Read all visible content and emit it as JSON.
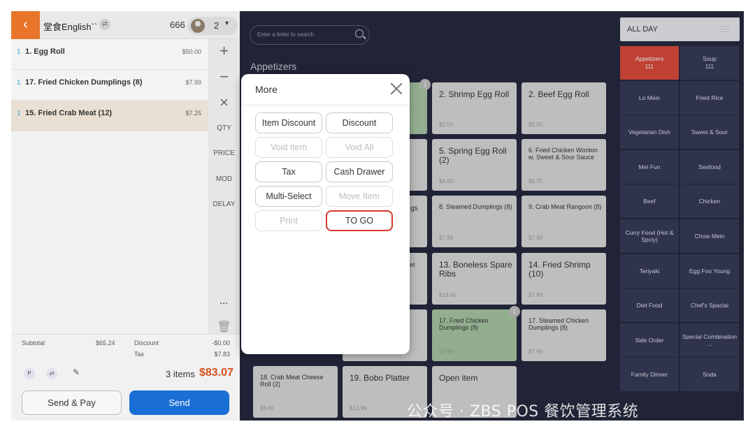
{
  "header": {
    "back_icon": "chevron-left-icon",
    "store_name": "堂食English``",
    "table_number": "666",
    "guest_count": "2"
  },
  "order_items": [
    {
      "qty": "1",
      "name": "1. Egg Roll",
      "price": "$50.00",
      "selected": false
    },
    {
      "qty": "1",
      "name": "17. Fried Chicken Dumplings (8)",
      "price": "$7.99",
      "selected": false
    },
    {
      "qty": "1",
      "name": "15. Fried Crab Meat (12)",
      "price": "$7.25",
      "selected": true
    }
  ],
  "side_tools": {
    "add": "+",
    "minus": "−",
    "remove": "×",
    "qty": "QTY",
    "price": "PRICE",
    "mod": "MOD",
    "delay": "DELAY",
    "more": "···"
  },
  "totals": {
    "subtotal_label": "Subtotal",
    "subtotal_value": "$65.24",
    "discount_label": "Discount",
    "discount_value": "-$0.00",
    "tax_label": "Tax",
    "tax_value": "$7.83",
    "p_badge": "P",
    "items_count": "3 items",
    "grand_total": "$83.07"
  },
  "actions": {
    "send_pay": "Send & Pay",
    "send": "Send"
  },
  "search": {
    "placeholder": "Enter a letter to search"
  },
  "category_title": "Appetizers",
  "menu_tiles": [
    {
      "name": "2. Shrimp Egg Roll",
      "price": "$2.50",
      "small": false,
      "green": false,
      "badge": ""
    },
    {
      "name": "2. Beef Egg Roll",
      "price": "$2.50",
      "small": false,
      "green": false,
      "badge": ""
    },
    {
      "name": "5. Spring Egg Roll (2)",
      "price": "$4.00",
      "small": false,
      "green": false,
      "badge": ""
    },
    {
      "name": "6. Fried Chicken Wonton w. Sweet & Sour Sauce",
      "price": "$5.75",
      "small": true,
      "green": false,
      "badge": ""
    },
    {
      "name": "8. Steamed Dumplings (8)",
      "price": "$7.99",
      "small": true,
      "green": false,
      "badge": ""
    },
    {
      "name": "9. Crab Meat Rangoon (8)",
      "price": "$7.99",
      "small": true,
      "green": false,
      "badge": ""
    },
    {
      "name": "13. Boneless Spare Ribs",
      "price": "$13.45",
      "small": false,
      "green": false,
      "badge": ""
    },
    {
      "name": "14. Fried Shrimp (10)",
      "price": "$7.99",
      "small": false,
      "green": false,
      "badge": ""
    },
    {
      "name": "17. Fried Chicken Dumplings (8)",
      "price": "$7.99",
      "small": true,
      "green": true,
      "badge": "1"
    },
    {
      "name": "17. Steamed Chicken Dumplings (8)",
      "price": "$7.99",
      "small": true,
      "green": false,
      "badge": ""
    },
    {
      "name": "18. Crab Meat Cheese Roll (2)",
      "price": "$5.00",
      "small": true,
      "green": false,
      "badge": ""
    },
    {
      "name": "19. Bobo Platter",
      "price": "$13.99",
      "small": false,
      "green": false,
      "badge": ""
    },
    {
      "name": "Open item",
      "price": "",
      "small": false,
      "green": false,
      "badge": ""
    }
  ],
  "partial_tile_fragments": {
    "badge_top": "1",
    "frag_gs": "gs",
    "frag_let": "let"
  },
  "menu_period": "ALL DAY",
  "categories": [
    {
      "label": "Appetizers",
      "count": "111",
      "active": true
    },
    {
      "label": "Soup",
      "count": "111",
      "active": false
    },
    {
      "label": "Lo Mein",
      "count": "",
      "active": false
    },
    {
      "label": "Fried Rice",
      "count": "",
      "active": false
    },
    {
      "label": "Vegetarian Dish",
      "count": "",
      "active": false
    },
    {
      "label": "Sweet & Sour",
      "count": "",
      "active": false
    },
    {
      "label": "Mei Fun",
      "count": "",
      "active": false
    },
    {
      "label": "Seafood",
      "count": "",
      "active": false
    },
    {
      "label": "Beef",
      "count": "",
      "active": false
    },
    {
      "label": "Chicken",
      "count": "",
      "active": false
    },
    {
      "label": "Curry Food (Hot & Spciy)",
      "count": "",
      "active": false
    },
    {
      "label": "Chow Mein",
      "count": "",
      "active": false
    },
    {
      "label": "Teriyaki",
      "count": "",
      "active": false
    },
    {
      "label": "Egg Foo Young",
      "count": "",
      "active": false
    },
    {
      "label": "Diet Food",
      "count": "",
      "active": false
    },
    {
      "label": "Chef's Spacial",
      "count": "",
      "active": false
    },
    {
      "label": "Side Order",
      "count": "",
      "active": false
    },
    {
      "label": "Special Combination ...",
      "count": "",
      "active": false
    },
    {
      "label": "Family Dinner",
      "count": "",
      "active": false
    },
    {
      "label": "Soda",
      "count": "",
      "active": false
    }
  ],
  "modal": {
    "title": "More",
    "buttons": [
      {
        "label": "Item Discount",
        "disabled": false,
        "highlight": false
      },
      {
        "label": "Discount",
        "disabled": false,
        "highlight": false
      },
      {
        "label": "Void Item",
        "disabled": true,
        "highlight": false
      },
      {
        "label": "Void All",
        "disabled": true,
        "highlight": false
      },
      {
        "label": "Tax",
        "disabled": false,
        "highlight": false
      },
      {
        "label": "Cash Drawer",
        "disabled": false,
        "highlight": false
      },
      {
        "label": "Multi-Select",
        "disabled": false,
        "highlight": false
      },
      {
        "label": "Move Item",
        "disabled": true,
        "highlight": false
      },
      {
        "label": "Print",
        "disabled": true,
        "highlight": false
      },
      {
        "label": "TO GO",
        "disabled": false,
        "highlight": true
      }
    ]
  },
  "watermark": "公众号 · ZBS POS 餐饮管理系统",
  "colors": {
    "accent_orange": "#e8752a",
    "send_blue": "#1a6fd4",
    "total_red": "#d4521c",
    "active_category": "#d94a3c",
    "highlight_border": "#d9382e",
    "ordered_tile_green": "#a7c6a3"
  }
}
